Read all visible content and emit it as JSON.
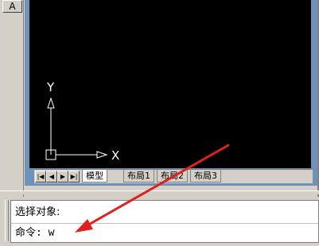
{
  "left_strip": {
    "button_label": "A"
  },
  "canvas": {
    "background": "#000000",
    "ucs": {
      "y_label": "Y",
      "x_label": "X"
    }
  },
  "tabs": {
    "nav": [
      "first-icon",
      "prev-icon",
      "next-icon",
      "last-icon"
    ],
    "items": [
      {
        "label": "模型",
        "active": true
      },
      {
        "label": "布局1",
        "active": false
      },
      {
        "label": "布局2",
        "active": false
      },
      {
        "label": "布局3",
        "active": false
      }
    ]
  },
  "command_window": {
    "history_line": "选择对象:",
    "prompt_line": "命令: w"
  },
  "annotation": {
    "arrow_color": "#e02020"
  }
}
